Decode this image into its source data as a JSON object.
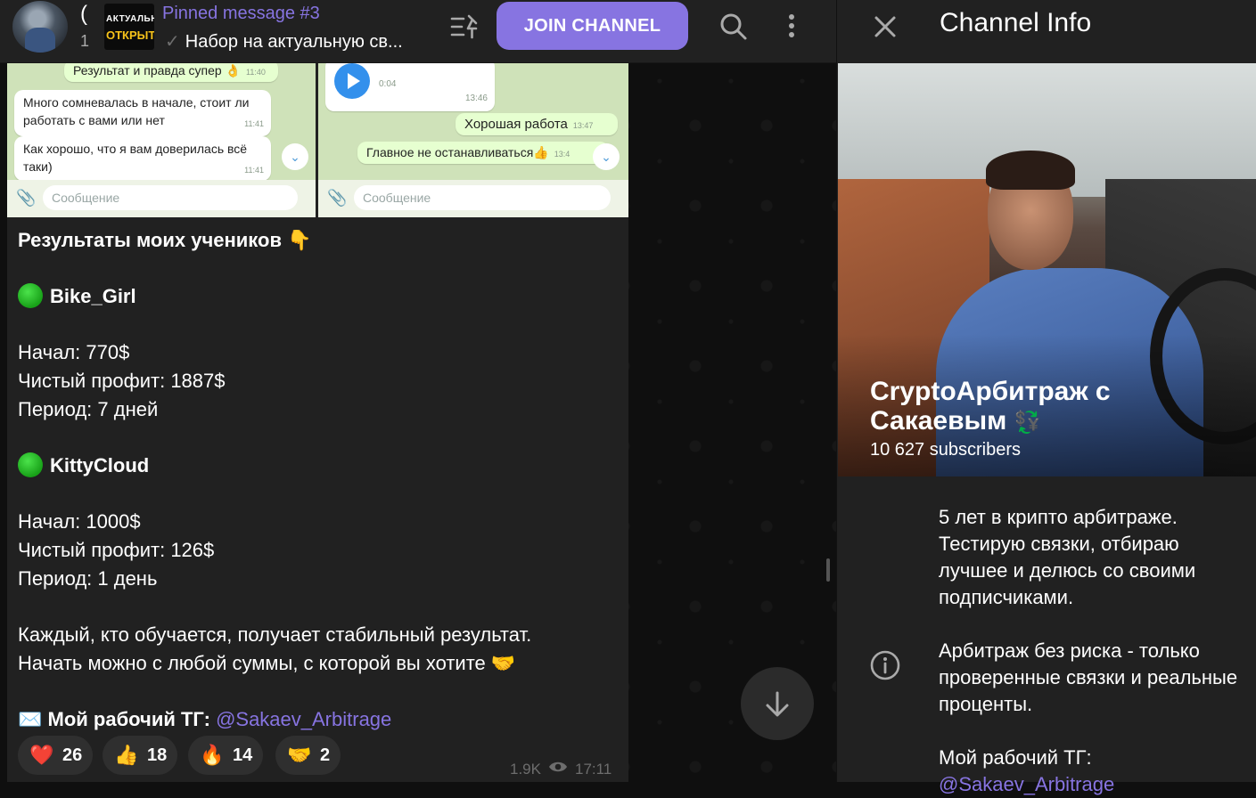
{
  "header": {
    "name_fragment": "(",
    "count_fragment": "1",
    "pinned_thumb_line1": "АКТУАЛЬН",
    "pinned_thumb_line2": "ОТКРЫТ",
    "pinned_title": "Pinned message #3",
    "pinned_text": "Набор на актуальную св...",
    "join_label": "JOIN CHANNEL"
  },
  "photos": {
    "left": {
      "top_bubble": "Результат и правда супер 👌",
      "top_time": "11:40",
      "bubble1": "Много сомневалась в начале, стоит ли работать с вами или нет",
      "bubble1_time": "11:41",
      "bubble2": "Как хорошо, что я вам доверилась всё таки)",
      "bubble2_time": "11:41",
      "input_placeholder": "Сообщение"
    },
    "right": {
      "voice_duration": "0:04",
      "voice_time": "13:46",
      "bubble1": "Хорошая работа",
      "bubble1_time": "13:47",
      "bubble2": "Главное не останавливаться👍",
      "bubble2_time": "13:4",
      "input_placeholder": "Сообщение"
    }
  },
  "message": {
    "heading": "Результаты моих учеников 👇",
    "student1_name": "Bike_Girl",
    "student1_start": "Начал: 770$",
    "student1_profit": "Чистый профит: 1887$",
    "student1_period": "Период: 7 дней",
    "student2_name": "KittyCloud",
    "student2_start": "Начал: 1000$",
    "student2_profit": "Чистый профит: 126$",
    "student2_period": "Период: 1 день",
    "closing1": "Каждый, кто обучается, получает стабильный результат.",
    "closing2": "Начать можно с любой суммы, с которой вы хотите 🤝",
    "contact_prefix": "✉️ Мой рабочий ТГ: ",
    "contact_link": "@Sakaev_Arbitrage",
    "views": "1.9K",
    "time": "17:11"
  },
  "reactions": [
    {
      "emoji": "❤️",
      "count": "26"
    },
    {
      "emoji": "👍",
      "count": "18"
    },
    {
      "emoji": "🔥",
      "count": "14"
    },
    {
      "emoji": "🤝",
      "count": "2"
    }
  ],
  "panel": {
    "title": "Channel Info",
    "channel_name": "CryptoАрбитраж с Сакаевым",
    "channel_name_icon": "💱",
    "subscribers": "10 627 subscribers",
    "bio1": "5 лет в крипто арбитраже. Тестирую связки, отбираю лучшее и делюсь со своими подписчиками.",
    "bio2": "Арбитраж без риска - только проверенные связки и реальные проценты.",
    "bio3": "Мой рабочий ТГ:",
    "bio4": "@Sakaev_Arbitrage"
  },
  "colors": {
    "accent": "#8774e1",
    "panel_bg": "#212121",
    "chat_bg": "#0f0f0f"
  }
}
